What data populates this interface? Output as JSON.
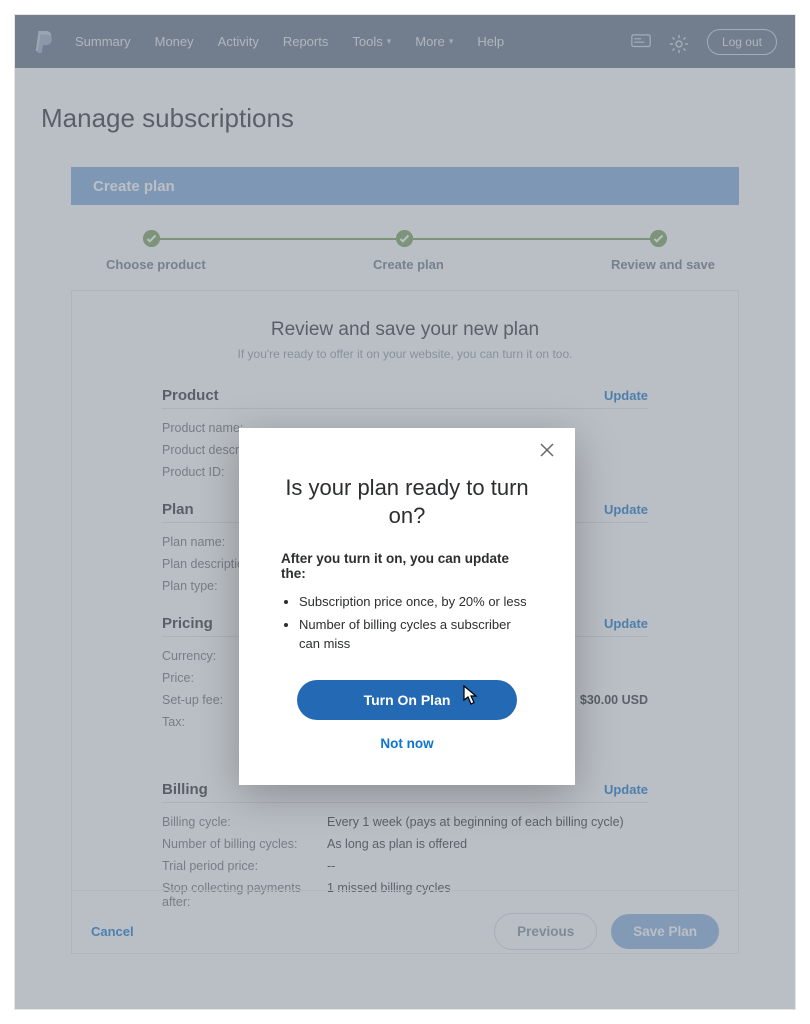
{
  "nav": {
    "items": [
      "Summary",
      "Money",
      "Activity",
      "Reports",
      "Tools",
      "More",
      "Help"
    ],
    "logout": "Log out"
  },
  "page": {
    "title": "Manage subscriptions",
    "banner": "Create plan"
  },
  "stepper": {
    "s1": "Choose product",
    "s2": "Create plan",
    "s3": "Review and save"
  },
  "review": {
    "title": "Review and save your new plan",
    "subtitle": "If you're ready to offer it on your website, you can turn it on too.",
    "update": "Update",
    "product": {
      "title": "Product",
      "fields": {
        "name_l": "Product name:",
        "name_v": "",
        "desc_l": "Product description:",
        "desc_v": "",
        "id_l": "Product ID:",
        "id_v": ""
      }
    },
    "plan": {
      "title": "Plan",
      "fields": {
        "name_l": "Plan name:",
        "name_v": "",
        "desc_l": "Plan description:",
        "desc_v": "",
        "type_l": "Plan type:",
        "type_v": ""
      }
    },
    "pricing": {
      "title": "Pricing",
      "fields": {
        "curr_l": "Currency:",
        "curr_v": "",
        "price_l": "Price:",
        "price_v": "",
        "setup_l": "Set-up fee:",
        "setup_v": "$30.00 USD",
        "tax_l": "Tax:",
        "tax_v": ""
      }
    },
    "billing": {
      "title": "Billing",
      "fields": {
        "cycle_l": "Billing cycle:",
        "cycle_v": "Every 1 week (pays at beginning of each billing cycle)",
        "num_l": "Number of billing cycles:",
        "num_v": "As long as plan is offered",
        "trial_l": "Trial period price:",
        "trial_v": "--",
        "stop_l": "Stop collecting payments after:",
        "stop_v": "1 missed billing cycles"
      }
    }
  },
  "actions": {
    "cancel": "Cancel",
    "previous": "Previous",
    "save": "Save Plan"
  },
  "modal": {
    "title": "Is your plan ready to turn on?",
    "subtitle": "After you turn it on, you can update the:",
    "bullets": {
      "b1": "Subscription price once, by 20% or less",
      "b2": "Number of billing cycles a subscriber can miss"
    },
    "turn_on": "Turn On Plan",
    "not_now": "Not now"
  }
}
